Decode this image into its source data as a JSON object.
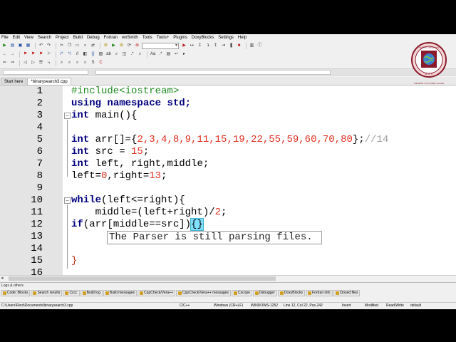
{
  "menu": [
    "File",
    "Edit",
    "View",
    "Search",
    "Project",
    "Build",
    "Debug",
    "Fortran",
    "wxSmith",
    "Tools",
    "Tools+",
    "Plugins",
    "DoxyBlocks",
    "Settings",
    "Help"
  ],
  "tabs": [
    "Start here",
    "*binarysearch3.cpp"
  ],
  "editor": {
    "line_numbers": [
      "1",
      "2",
      "3",
      "4",
      "5",
      "6",
      "7",
      "8",
      "9",
      "10",
      "11",
      "12",
      "13",
      "14",
      "15",
      "16"
    ]
  },
  "code": {
    "l1": "#include<iostream>",
    "l2_kw1": "using",
    "l2_kw2": "namespace",
    "l2_id": "std;",
    "l3_kw": "int",
    "l3_rest": " main(){",
    "l5_kw": "int",
    "l5_a": " arr[]={",
    "l5_nums": "2,3,4,8,9,11,15,19,22,55,59,60,70,80",
    "l5_b": "};",
    "l5_cm": "//14",
    "l6_kw": "int",
    "l6_a": " src = ",
    "l6_num": "15",
    "l6_b": ";",
    "l7_kw": "int",
    "l7_rest": " left, right,middle;",
    "l8_a": "left=",
    "l8_n1": "0",
    "l8_b": ",right=",
    "l8_n2": "13",
    "l8_c": ";",
    "l10_kw": "while",
    "l10_rest": "(left<=right){",
    "l11_a": "    middle=(left+right)/",
    "l11_num": "2",
    "l11_b": ";",
    "l12_kw": "if",
    "l12_rest": "(arr[middle==src])",
    "l12_br": "{}",
    "l15": "}"
  },
  "tooltip": "The Parser is still parsing files.",
  "logs": {
    "title": "Logs & others",
    "tabs": [
      "Code::Blocks",
      "Search results",
      "Cccc",
      "Build log",
      "Build messages",
      "CppCheck/Vera++",
      "CppCheck/Vera++ messages",
      "Cscope",
      "Debugger",
      "DoxyBlocks",
      "Fortran info",
      "Closed files"
    ]
  },
  "status": {
    "path": "C:\\Users\\Root\\Documents\\binarysearch3.cpp",
    "lang": "C/C++",
    "eol": "Windows (CR+LF)",
    "enc": "WINDOWS-1252",
    "pos": "Line 12, Col 22, Pos 242",
    "mode": "Insert",
    "mod": "Modified",
    "rw": "Read/Write",
    "def": "default"
  },
  "logo": {
    "text_top": "পাবলিক বিশ্ববিদ্যালয়",
    "letters": "U G V",
    "text_bottom": "UNIVERSITY OF GLOBAL VILLAGE"
  },
  "colors": {
    "preprocessor": "#1e8a1e",
    "keyword": "#00007f",
    "number": "#e0301e",
    "comment": "#a0a0a0",
    "brace_highlight": "#7fe0ff",
    "logo_maroon": "#8b1a2a"
  }
}
